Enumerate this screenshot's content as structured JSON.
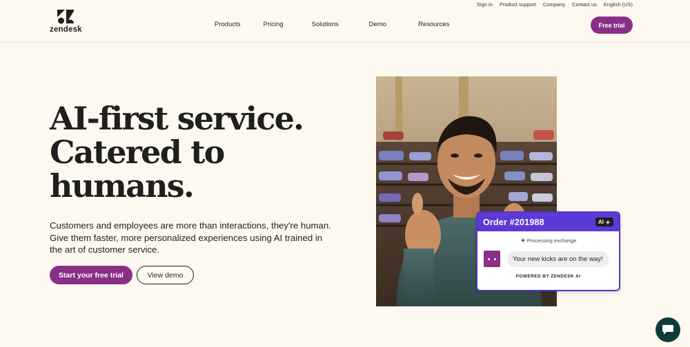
{
  "utility": {
    "sign_in": "Sign in",
    "product_support": "Product support",
    "company": "Company",
    "contact_us": "Contact us",
    "language": "English (US)"
  },
  "header": {
    "logo_text": "zendesk",
    "nav": [
      "Products",
      "Pricing",
      "Solutions",
      "Demo",
      "Resources"
    ],
    "free_trial": "Free trial"
  },
  "hero": {
    "headline": [
      "AI-first service.",
      "Catered to",
      "humans."
    ],
    "subtext": [
      "Customers and employees are more than interactions, they're human.",
      "Give them faster, more personalized experiences using AI trained in",
      "the art of customer service."
    ],
    "cta_primary": "Start your free trial",
    "cta_secondary": "View demo"
  },
  "chat_card": {
    "title": "Order #201988",
    "badge": "AI",
    "status": "Processing exchange",
    "message": "Your new kicks are on the way!",
    "footer": "POWERED BY ZENDESK AI"
  },
  "colors": {
    "background": "#fdf9f0",
    "brand_purple": "#8a2f86",
    "card_accent": "#5b3ad8",
    "launcher": "#0f3a3a"
  },
  "icons": {
    "logo": "zendesk-logo-icon",
    "sparkle": "sparkle-icon",
    "chat": "chat-bubble-icon"
  }
}
